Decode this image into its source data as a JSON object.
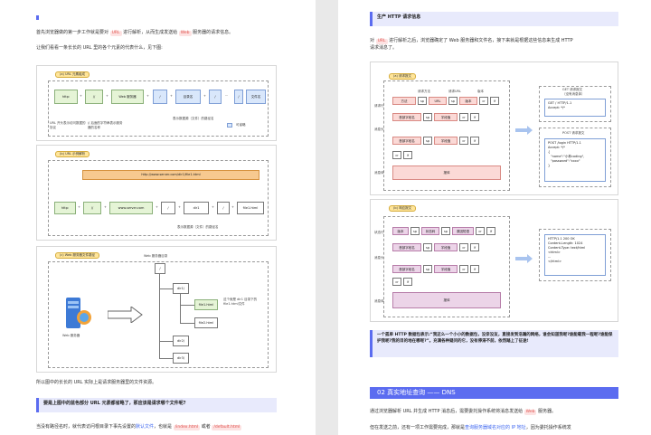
{
  "left": {
    "p1": [
      "首先浏览器做的第一步工作就是要对 ",
      "URL",
      " 进行解析，从而生成发送给 ",
      "Web",
      " 服务器的请求信息。"
    ],
    "p2": "让我们看看一条长长的 URL 里的各个元素的代表什么，见下图:",
    "fig_a": {
      "tag": "(a)  URL 元素组成",
      "boxes": [
        "http:",
        "//",
        "Web 服务器",
        "/",
        "目录名",
        "/",
        "···",
        "/",
        "文件名"
      ],
      "plus": "+",
      "note1": "URL 开头表示访问数据的协议",
      "note2": "// 后面的字符串表示服务器的名称",
      "note3": "表示数据源（文件）的路径名",
      "legend": "可省略"
    },
    "fig_b": {
      "tag": "(b)  URL 示例解析",
      "url": "http://www.server.com/dir1/file1.html",
      "boxes": [
        "http:",
        "//",
        "www.server.com",
        "/",
        "dir1",
        "/",
        "file1.html"
      ],
      "plus": "+",
      "note": "表示数据源（文件）的路径名"
    },
    "fig_c": {
      "tag": "(c)  Web 服务器文件路径",
      "root_title": "Web 服务器目录",
      "server_label": "Web 服务器",
      "nodes": [
        "/",
        "dir1/",
        "file1.html",
        "file2.html",
        "dir2/",
        "dir3/"
      ],
      "note": "这个就是 dir1 目录下的 file1.html文件"
    },
    "p3": "所以图中的长长的 URL 实际上是请求服务器里的文件资源。",
    "callout": "要是上图中的蓝色部分 URL 元素都省略了，那应该是请求哪个文件呢?",
    "p4": [
      "当没有路径名时，就代表访问根目录下事先设置的",
      "默认文件",
      "，也就是 ",
      "/index.html",
      " 或者 ",
      "/default.html"
    ]
  },
  "right": {
    "callout1": "生产 HTTP 请求信息",
    "p1": [
      "对 ",
      "URL",
      " 进行解析之后，浏览器确定了 Web 服务器和文件名，接下来就是根据这些信息来生成 HTTP"
    ],
    "p1b": "请求消息了。",
    "fig_a": {
      "tag": "(a) 请求报文",
      "col1": "请求方法",
      "col2": "请求URL",
      "col3": "版本",
      "row_label1": "请求行",
      "row_label2": "消息头",
      "row_label3": "消息体",
      "line1": [
        "方法",
        "sp",
        "URL",
        "sp",
        "版本",
        "cr",
        "lf"
      ],
      "hdr": [
        "首部字段名",
        "sp",
        "字段值",
        "cr",
        "lf"
      ],
      "crlf": [
        "cr",
        "lf"
      ],
      "body": "报体",
      "get_title": "GET 请求报文",
      "get_sub": "（没有消息体）",
      "get_code": [
        "GET / HTTP/1.1",
        "Accept: */*"
      ],
      "post_title": "POST 请求报文",
      "post_code": [
        "POST /login HTTP/1.1",
        "Accept: */*",
        "{",
        "\"name\":\"小林coding\",",
        "\"password\":\"xxxx\"",
        "}"
      ]
    },
    "fig_b": {
      "tag": "(b) 响应报文",
      "row_label1": "状态行",
      "row_label2": "消息头",
      "row_label3": "消息体",
      "line1": [
        "版本",
        "sp",
        "状态码",
        "sp",
        "原因短语",
        "cr",
        "lf"
      ],
      "hdr": [
        "首部字段名",
        "sp",
        "字段值",
        "cr",
        "lf"
      ],
      "crlf": [
        "cr",
        "lf"
      ],
      "body": "报体",
      "resp_code": [
        "HTTP/1.1 200 OK",
        "Content-Length: 1024",
        "Content-Type: text/html",
        "",
        "<html>",
        "...",
        "</html>"
      ]
    },
    "callout2": "一个孤单 HTTP 数据包表示:“我这么一个小小的数据包，没亲没友，直接发到浩瀚的网络，谁会知道我呢?谁能载我一程呢?谁能保护我呢?我的目的地在哪呢?”。充满各种疑问的它，没有停滞不前，依然踏上了征途!",
    "h2": "02 真实地址查询 —— DNS",
    "p2": [
      "通过浏览器解析 URL 并生成 HTTP 消息后，需要委托操作系统将消息发送给 ",
      "Web",
      " 服务器。"
    ],
    "p3": [
      "但在发送之前，还有一项工作需要完成，那就是",
      "查询服务器域名对应的 IP 地址",
      "，因为委托操作系统发"
    ]
  }
}
